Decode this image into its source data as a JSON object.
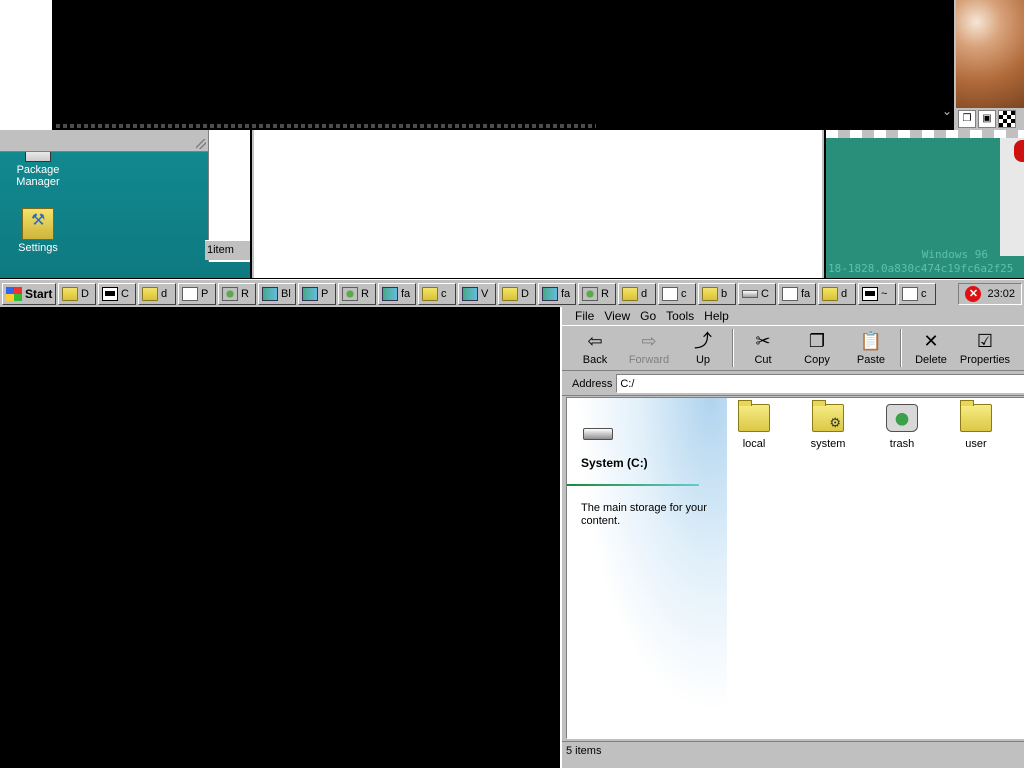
{
  "desktop": {
    "icons": [
      {
        "label": "Package Manager",
        "icon": "package-manager-icon"
      },
      {
        "label": "Settings",
        "icon": "settings-icon"
      }
    ],
    "mini_status": "1item",
    "watermark_line1": "Windows 96",
    "watermark_line2": "18-1828.0a830c474c19fc6a2f25"
  },
  "taskbar": {
    "start_label": "Start",
    "tasks": [
      {
        "icon": "folder",
        "label": "D"
      },
      {
        "icon": "term",
        "label": "C"
      },
      {
        "icon": "folder",
        "label": "d"
      },
      {
        "icon": "doc",
        "label": "P"
      },
      {
        "icon": "recycle",
        "label": "R"
      },
      {
        "icon": "pkg",
        "label": "Bl"
      },
      {
        "icon": "pkg",
        "label": "P"
      },
      {
        "icon": "recycle",
        "label": "R"
      },
      {
        "icon": "pkg",
        "label": "fa"
      },
      {
        "icon": "folder",
        "label": "c"
      },
      {
        "icon": "pkg",
        "label": "V"
      },
      {
        "icon": "folder",
        "label": "D"
      },
      {
        "icon": "pkg",
        "label": "fa"
      },
      {
        "icon": "recycle",
        "label": "R"
      },
      {
        "icon": "folder",
        "label": "d"
      },
      {
        "icon": "doc",
        "label": "c"
      },
      {
        "icon": "folder",
        "label": "b"
      },
      {
        "icon": "drive",
        "label": "C"
      },
      {
        "icon": "doc",
        "label": "fa"
      },
      {
        "icon": "folder",
        "label": "d"
      },
      {
        "icon": "term",
        "label": "~"
      },
      {
        "icon": "doc",
        "label": "c"
      }
    ],
    "clock": "23:02"
  },
  "explorer": {
    "menu": [
      "File",
      "View",
      "Go",
      "Tools",
      "Help"
    ],
    "toolbar": [
      {
        "label": "Back",
        "glyph": "⇦",
        "enabled": true
      },
      {
        "label": "Forward",
        "glyph": "⇨",
        "enabled": false
      },
      {
        "label": "Up",
        "glyph": "⤴",
        "enabled": true
      },
      {
        "label": "Cut",
        "glyph": "✂",
        "enabled": true
      },
      {
        "label": "Copy",
        "glyph": "❐",
        "enabled": true
      },
      {
        "label": "Paste",
        "glyph": "📋",
        "enabled": true
      },
      {
        "label": "Delete",
        "glyph": "✕",
        "enabled": true
      },
      {
        "label": "Properties",
        "glyph": "☑",
        "enabled": true
      }
    ],
    "address_label": "Address",
    "address_value": "C:/",
    "info": {
      "title": "System (C:)",
      "description": "The main storage for your content."
    },
    "files": [
      {
        "name": "local",
        "type": "folder"
      },
      {
        "name": "system",
        "type": "system-folder"
      },
      {
        "name": "trash",
        "type": "trash"
      },
      {
        "name": "user",
        "type": "folder"
      }
    ],
    "status": "5 items"
  }
}
